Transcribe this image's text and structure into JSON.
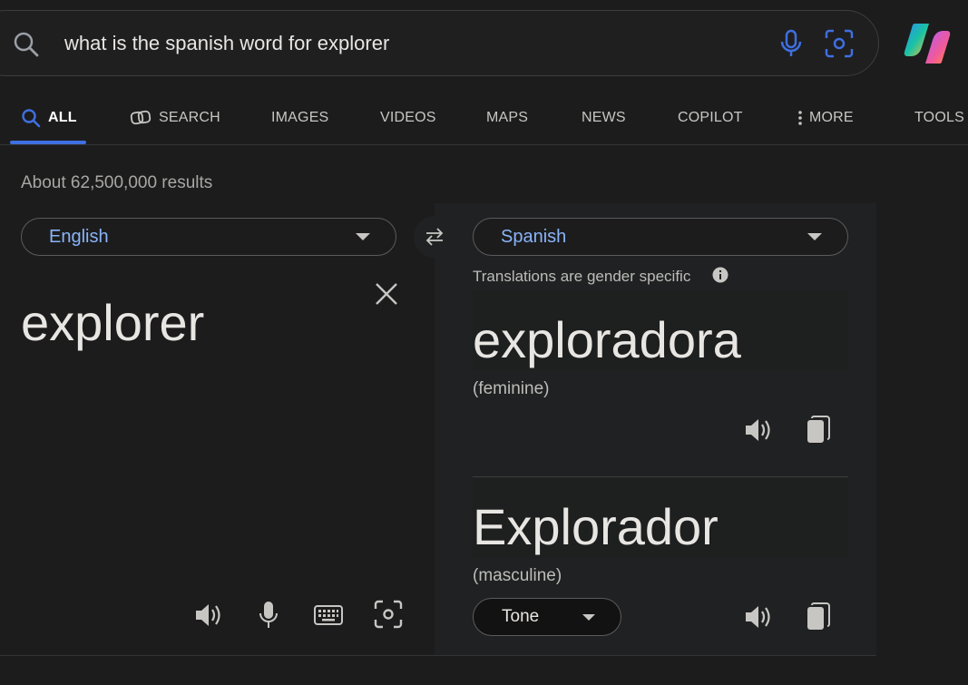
{
  "search": {
    "query": "what is the spanish word for explorer"
  },
  "tabs": [
    {
      "label": "ALL",
      "icon": "search-icon",
      "active": true
    },
    {
      "label": "SEARCH",
      "icon": "copilot-search-icon",
      "active": false
    },
    {
      "label": "IMAGES",
      "active": false
    },
    {
      "label": "VIDEOS",
      "active": false
    },
    {
      "label": "MAPS",
      "active": false
    },
    {
      "label": "NEWS",
      "active": false
    },
    {
      "label": "COPILOT",
      "active": false
    },
    {
      "label": "MORE",
      "icon": "more-vertical-icon",
      "active": false
    },
    {
      "label": "TOOLS",
      "active": false
    }
  ],
  "results": {
    "count_text": "About 62,500,000 results"
  },
  "translator": {
    "source_language": "English",
    "target_language": "Spanish",
    "source_text": "explorer",
    "gender_note": "Translations are gender specific",
    "translations": [
      {
        "word": "exploradora",
        "gender": "(feminine)"
      },
      {
        "word": "Explorador",
        "gender": "(masculine)"
      }
    ],
    "tone_label": "Tone"
  },
  "colors": {
    "accent": "#3f6fe0",
    "link": "#8ab4f8",
    "background": "#1c1c1d"
  }
}
